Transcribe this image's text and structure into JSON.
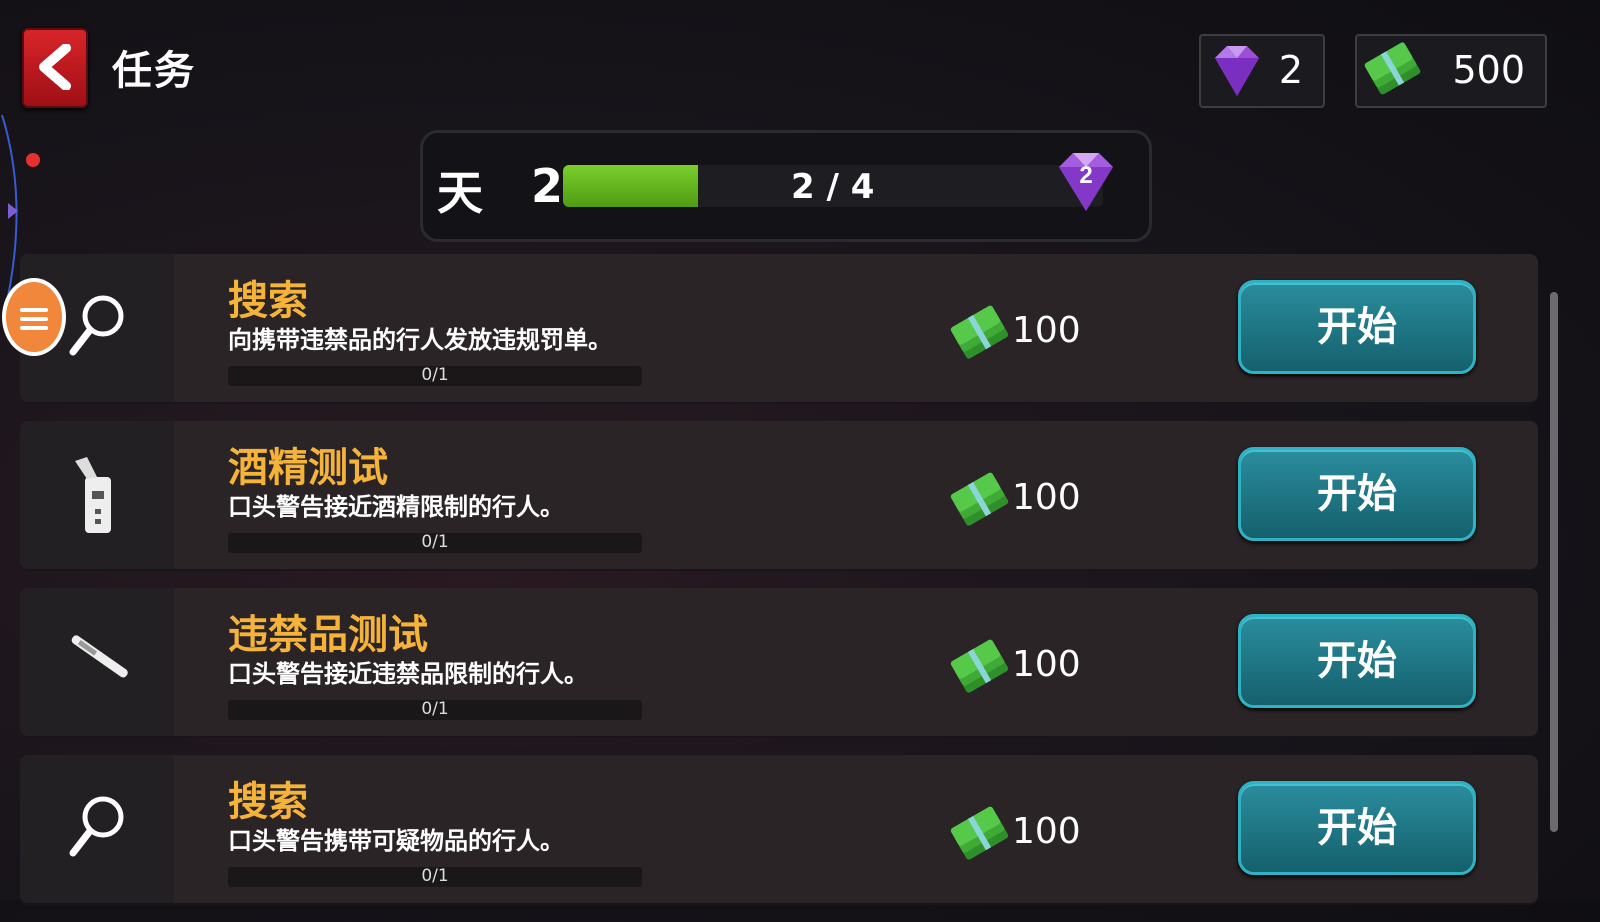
{
  "header": {
    "title": "任务"
  },
  "currency": {
    "gems": "2",
    "cash": "500"
  },
  "daily": {
    "label": "天",
    "day": "2",
    "progress_current": 2,
    "progress_total": 4,
    "progress_text": "2 / 4",
    "reward_gems": "2"
  },
  "tasks": [
    {
      "name": "搜索",
      "desc": "向携带违禁品的行人发放违规罚单。",
      "progress": "0/1",
      "reward": "100",
      "button": "开始",
      "icon": "magnifier-icon"
    },
    {
      "name": "酒精测试",
      "desc": "口头警告接近酒精限制的行人。",
      "progress": "0/1",
      "reward": "100",
      "button": "开始",
      "icon": "breathalyzer-icon"
    },
    {
      "name": "违禁品测试",
      "desc": "口头警告接近违禁品限制的行人。",
      "progress": "0/1",
      "reward": "100",
      "button": "开始",
      "icon": "swab-icon"
    },
    {
      "name": "搜索",
      "desc": "口头警告携带可疑物品的行人。",
      "progress": "0/1",
      "reward": "100",
      "button": "开始",
      "icon": "magnifier-icon"
    }
  ],
  "colors": {
    "task_title": "#f6b33a",
    "button": "#1f7f8e",
    "progress": "#6cbf24",
    "back": "#c81c22"
  }
}
